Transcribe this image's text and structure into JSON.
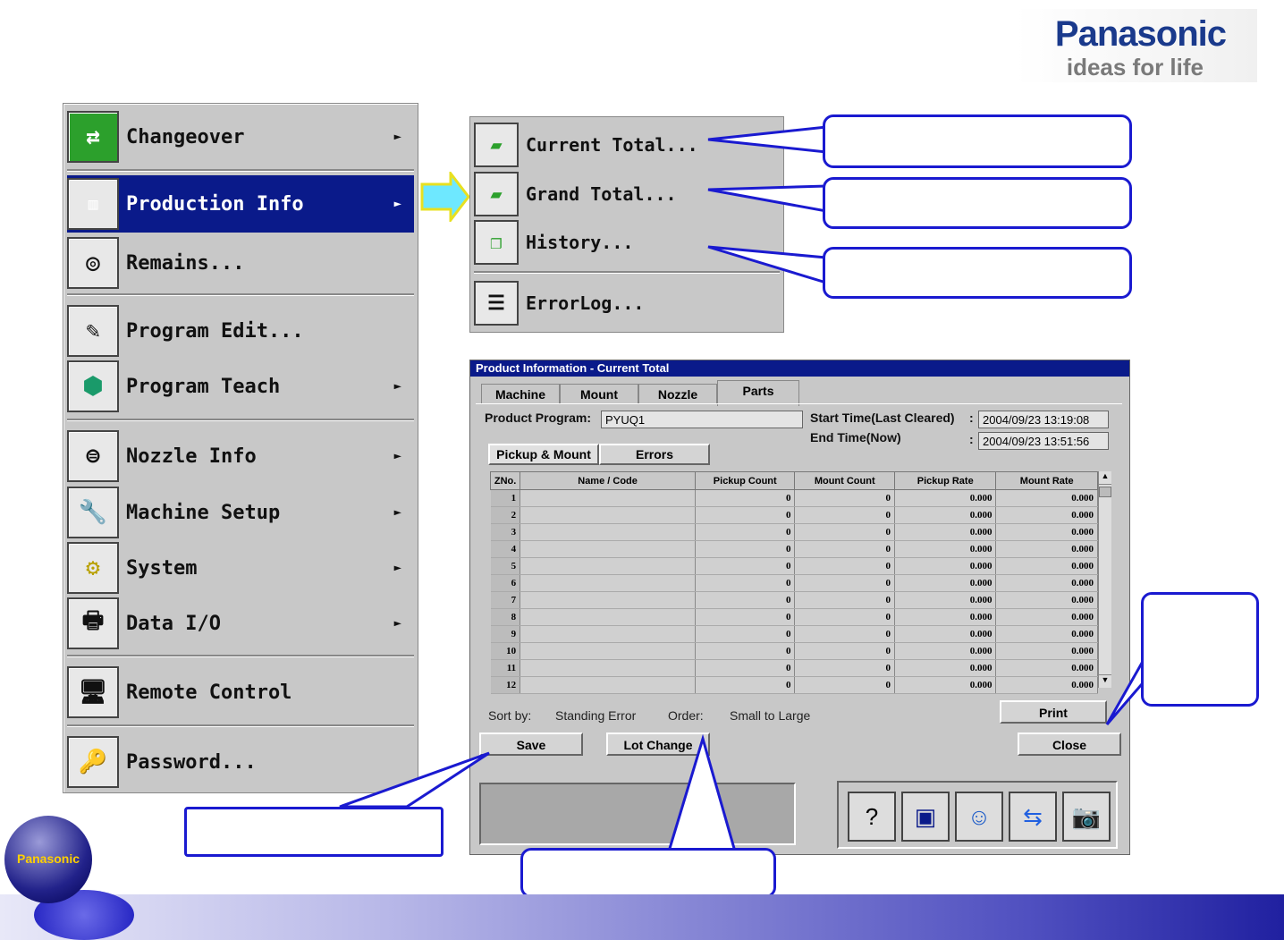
{
  "brand": {
    "logo": "Panasonic",
    "tagline": "ideas for life"
  },
  "main_menu": {
    "items": [
      {
        "label": "Changeover",
        "arrow": "►",
        "icon": "changeover-icon"
      },
      {
        "label": "Production Info",
        "arrow": "►",
        "icon": "log-chart-icon",
        "selected": true
      },
      {
        "label": "Remains...",
        "arrow": "",
        "icon": "reel-icon"
      },
      {
        "label": "Program Edit...",
        "arrow": "",
        "icon": "edit-document-icon"
      },
      {
        "label": "Program Teach",
        "arrow": "►",
        "icon": "teach-lens-icon"
      },
      {
        "label": "Nozzle Info",
        "arrow": "►",
        "icon": "nozzle-icon"
      },
      {
        "label": "Machine Setup",
        "arrow": "►",
        "icon": "wrench-icon"
      },
      {
        "label": "System",
        "arrow": "►",
        "icon": "system-gear-icon"
      },
      {
        "label": "Data I/O",
        "arrow": "►",
        "icon": "disk-printer-icon"
      },
      {
        "label": "Remote Control",
        "arrow": "",
        "icon": "computer-icon"
      },
      {
        "label": "Password...",
        "arrow": "",
        "icon": "key-lock-icon"
      }
    ]
  },
  "sub_menu": {
    "items": [
      {
        "label": "Current Total...",
        "icon": "current-total-icon"
      },
      {
        "label": "Grand Total...",
        "icon": "grand-total-icon"
      },
      {
        "label": "History...",
        "icon": "history-icon"
      },
      {
        "label": "ErrorLog...",
        "icon": "errorlog-icon"
      }
    ]
  },
  "dialog": {
    "title": "Product Information - Current Total",
    "tabs": [
      "Machine",
      "Mount",
      "Nozzle",
      "Parts"
    ],
    "active_tab": "Parts",
    "product_program_label": "Product Program:",
    "product_program_value": "PYUQ1",
    "start_time_label": "Start Time(Last Cleared)",
    "start_time_value": "2004/09/23 13:19:08",
    "end_time_label": "End Time(Now)",
    "end_time_value": "2004/09/23 13:51:56",
    "colon": ":",
    "subtabs": [
      "Pickup & Mount",
      "Errors"
    ],
    "columns": [
      "ZNo.",
      "Name / Code",
      "Pickup Count",
      "Mount Count",
      "Pickup Rate",
      "Mount Rate"
    ],
    "rows": [
      [
        "1",
        "",
        "0",
        "0",
        "0.000",
        "0.000"
      ],
      [
        "2",
        "",
        "0",
        "0",
        "0.000",
        "0.000"
      ],
      [
        "3",
        "",
        "0",
        "0",
        "0.000",
        "0.000"
      ],
      [
        "4",
        "",
        "0",
        "0",
        "0.000",
        "0.000"
      ],
      [
        "5",
        "",
        "0",
        "0",
        "0.000",
        "0.000"
      ],
      [
        "6",
        "",
        "0",
        "0",
        "0.000",
        "0.000"
      ],
      [
        "7",
        "",
        "0",
        "0",
        "0.000",
        "0.000"
      ],
      [
        "8",
        "",
        "0",
        "0",
        "0.000",
        "0.000"
      ],
      [
        "9",
        "",
        "0",
        "0",
        "0.000",
        "0.000"
      ],
      [
        "10",
        "",
        "0",
        "0",
        "0.000",
        "0.000"
      ],
      [
        "11",
        "",
        "0",
        "0",
        "0.000",
        "0.000"
      ],
      [
        "12",
        "",
        "0",
        "0",
        "0.000",
        "0.000"
      ]
    ],
    "sort_by_label": "Sort by:",
    "sort_by_value": "Standing Error",
    "order_label": "Order:",
    "order_value": "Small to Large",
    "buttons": {
      "print": "Print",
      "save": "Save",
      "lot_change": "Lot Change",
      "close": "Close"
    },
    "toolbar_icons": [
      "help-icon",
      "window-icon",
      "operator-icon",
      "transfer-icon",
      "camera-screen-icon"
    ]
  },
  "footer_logo": "Panasonic",
  "colors": {
    "menu_selected": "#0a1a8a",
    "callout_border": "#1a1ad0",
    "arrow_fill": "#6ee8ff",
    "arrow_stroke": "#e8e020"
  }
}
